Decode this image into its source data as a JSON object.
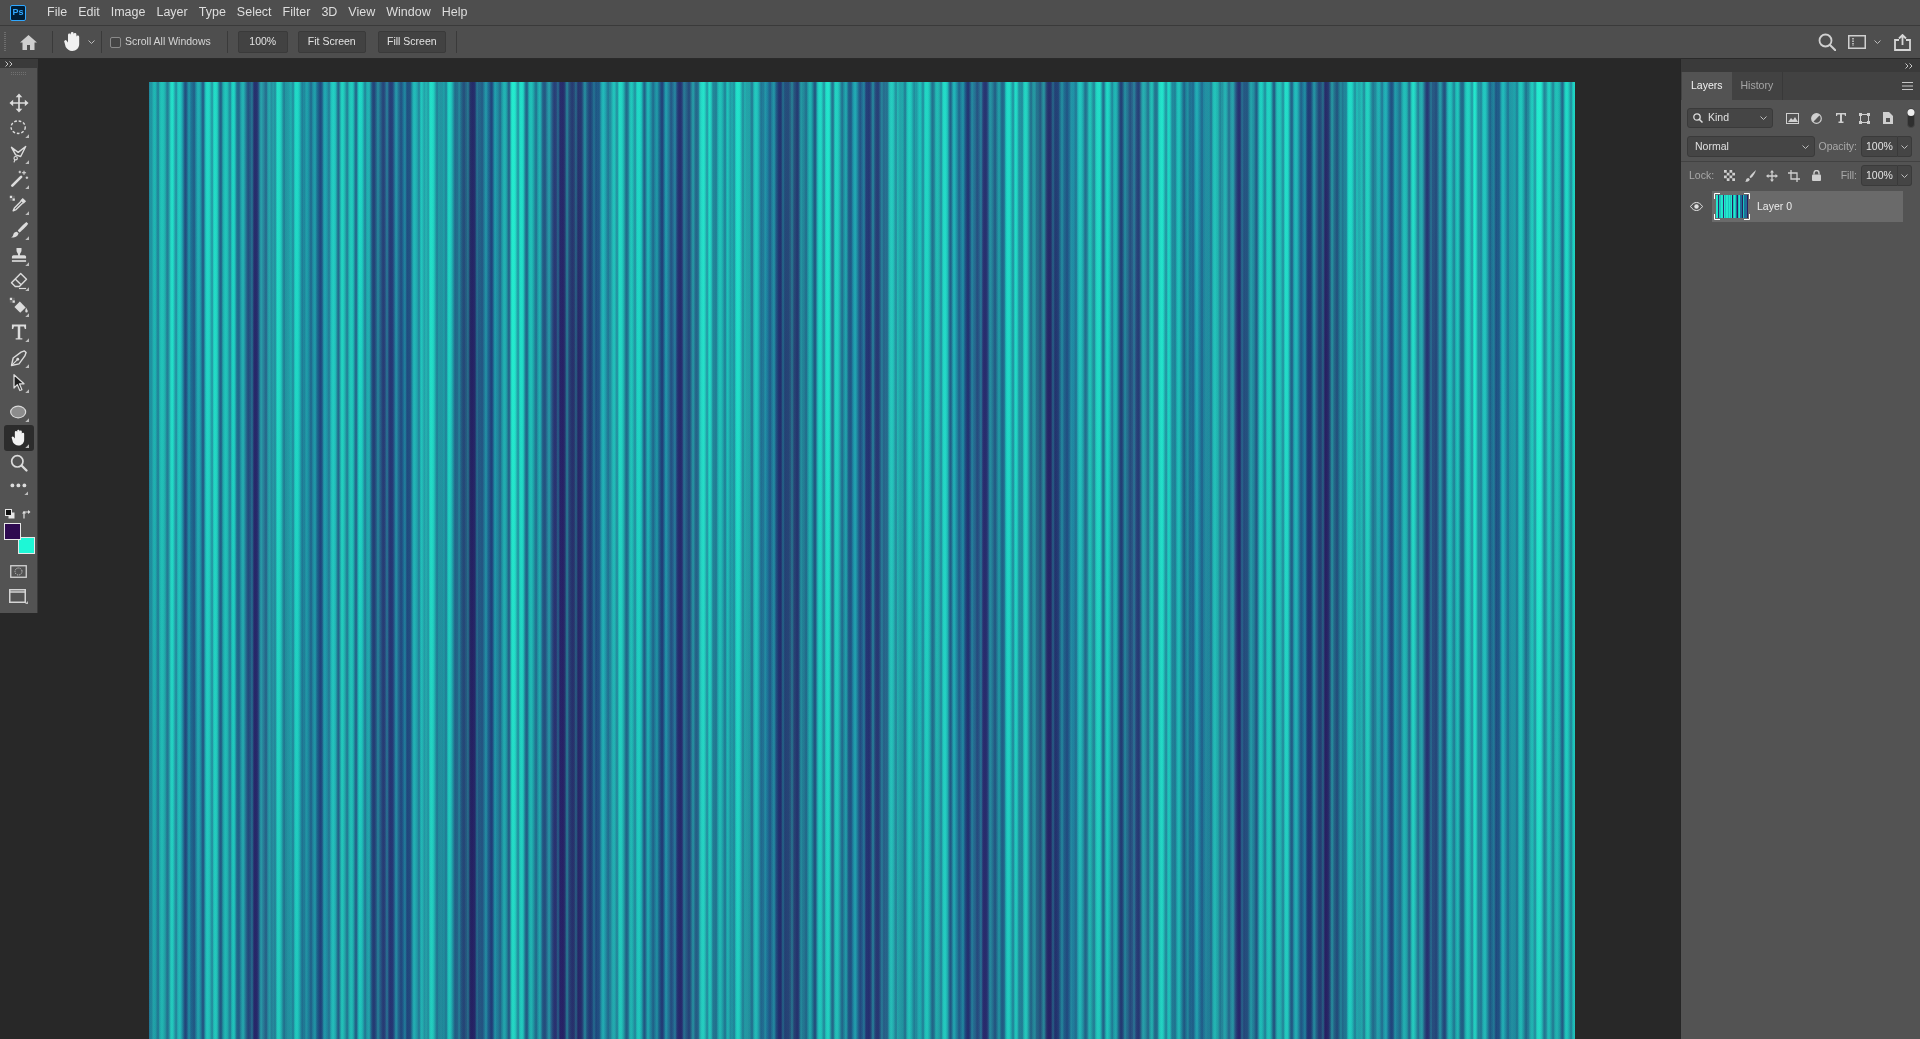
{
  "menu_bar": {
    "logo": "Ps",
    "items": [
      "File",
      "Edit",
      "Image",
      "Layer",
      "Type",
      "Select",
      "Filter",
      "3D",
      "View",
      "Window",
      "Help"
    ]
  },
  "options_bar": {
    "scroll_all_windows": {
      "label": "Scroll All Windows",
      "checked": false
    },
    "buttons": [
      "100%",
      "Fit Screen",
      "Fill Screen"
    ]
  },
  "toolbar": {
    "tools": [
      {
        "selected": false
      },
      {
        "selected": false
      },
      {
        "selected": false
      },
      {
        "selected": false
      },
      {
        "selected": false
      },
      {
        "selected": false
      },
      {
        "selected": false
      },
      {
        "selected": false
      },
      {
        "selected": false
      },
      {
        "selected": false
      },
      {
        "selected": false
      },
      {
        "selected": false
      },
      {
        "selected": false
      },
      {
        "selected": true
      },
      {
        "selected": false
      },
      {
        "selected": false
      }
    ],
    "color_swatches": [
      {
        "color": "#2e0a50"
      },
      {
        "color": "#1ef7d6"
      }
    ]
  },
  "layers_panel": {
    "tabs": [
      {
        "label": "Layers",
        "selected": true
      },
      {
        "label": "History",
        "selected": false
      }
    ],
    "filter_kind": "Kind",
    "filter_on": true,
    "blend_mode": "Normal",
    "opacity": {
      "label": "Opacity:",
      "value": "100%"
    },
    "lock_label": "Lock:",
    "fill": {
      "label": "Fill:",
      "value": "100%"
    },
    "layers": [
      {
        "name": "Layer 0",
        "visible": true,
        "selected": true
      }
    ]
  }
}
